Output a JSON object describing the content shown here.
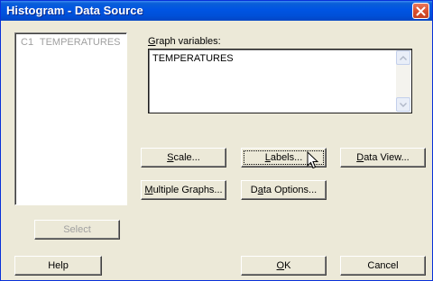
{
  "window": {
    "title": "Histogram - Data Source"
  },
  "variables_list": {
    "items": [
      {
        "column": "C1",
        "name": "TEMPERATURES"
      }
    ]
  },
  "graph_variables": {
    "label_hotkey": "G",
    "label_rest": "raph variables:",
    "value": "TEMPERATURES"
  },
  "buttons": {
    "scale": {
      "hotkey": "S",
      "rest": "cale..."
    },
    "labels": {
      "hotkey": "L",
      "rest": "abels..."
    },
    "data_view": {
      "hotkey": "D",
      "rest": "ata View..."
    },
    "multiple_graphs": {
      "hotkey": "M",
      "rest": "ultiple Graphs..."
    },
    "data_options": {
      "pre": "D",
      "hotkey": "a",
      "rest": "ta Options..."
    },
    "select": "Select",
    "help": "Help",
    "ok": {
      "hotkey": "O",
      "rest": "K"
    },
    "cancel": "Cancel"
  }
}
